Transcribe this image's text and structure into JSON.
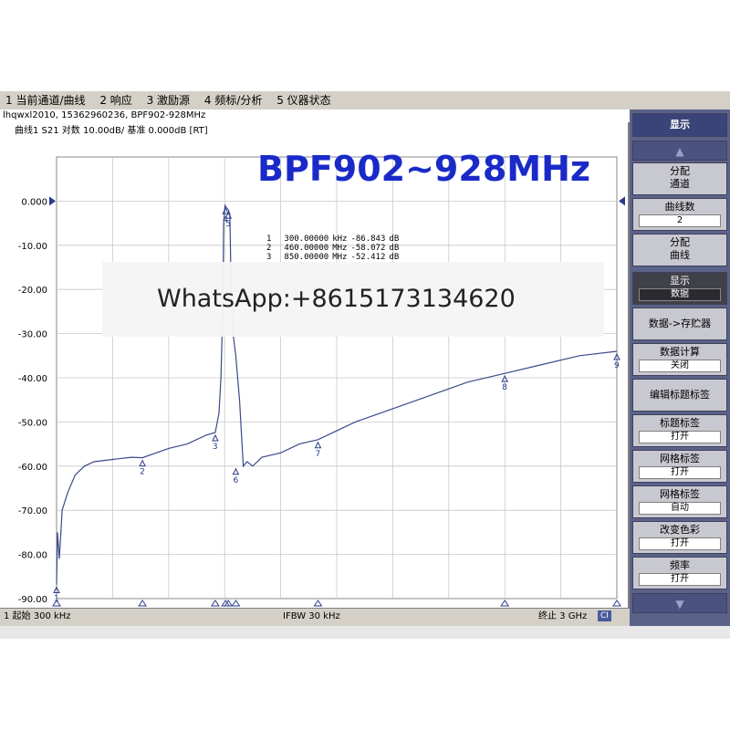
{
  "menubar": {
    "items": [
      "1 当前通道/曲线",
      "2 响应",
      "3 激励源",
      "4 频标/分析",
      "5 仪器状态"
    ]
  },
  "subtitle": "lhqwxl2010, 15362960236, BPF902-928MHz",
  "trace_header": "曲线1 S21 对数 10.00dB/ 基准 0.000dB [RT]",
  "plot_title": "BPF902~928MHz",
  "watermark": "WhatsApp:+8615173134620",
  "markers_table": [
    {
      "idx": "1",
      "freq": "300.00000",
      "unit": "kHz",
      "value": "-86.843",
      "vunit": "dB"
    },
    {
      "idx": "2",
      "freq": "460.00000",
      "unit": "MHz",
      "value": "-58.072",
      "vunit": "dB"
    },
    {
      "idx": "3",
      "freq": "850.00000",
      "unit": "MHz",
      "value": "-52.412",
      "vunit": "dB"
    }
  ],
  "status": {
    "start": "1 起始 300 kHz",
    "ifbw": "IFBW 30 kHz",
    "stop": "终止 3 GHz",
    "ci": "CI"
  },
  "softkeys": {
    "title": "显示",
    "up": "▲",
    "down": "▼",
    "items": [
      {
        "label": "分配\n通道",
        "value": ""
      },
      {
        "label": "曲线数",
        "value": "2"
      },
      {
        "label": "分配\n曲线",
        "value": ""
      },
      {
        "label": "显示",
        "value": "数据"
      },
      {
        "label": "数据->存贮器",
        "value": ""
      },
      {
        "label": "数据计算",
        "value": "关闭"
      },
      {
        "label": "编辑标题标签",
        "value": ""
      },
      {
        "label": "标题标签",
        "value": "打开"
      },
      {
        "label": "网格标签",
        "value": "打开"
      },
      {
        "label": "网格标签",
        "value": "自动"
      },
      {
        "label": "改变色彩",
        "value": "打开"
      },
      {
        "label": "频率",
        "value": "打开"
      }
    ]
  },
  "chart_data": {
    "type": "line",
    "y_ticks": [
      "0.000",
      "-10.00",
      "-20.00",
      "-30.00",
      "-40.00",
      "-50.00",
      "-60.00",
      "-70.00",
      "-80.00",
      "-90.00"
    ],
    "ylim": [
      -90,
      10
    ],
    "x_range_mhz": [
      0.3,
      3000
    ],
    "series": [
      {
        "x": [
          0.3,
          5,
          15,
          30,
          60,
          100,
          150,
          200,
          300,
          400,
          460,
          600,
          700,
          800,
          850,
          870,
          880,
          890,
          895,
          902,
          910,
          920,
          928,
          935,
          945,
          960,
          980,
          1000,
          1020,
          1050,
          1100,
          1200,
          1300,
          1400,
          1500,
          1600,
          1800,
          2000,
          2200,
          2400,
          2600,
          2800,
          3000
        ],
        "y": [
          -86.8,
          -75,
          -81,
          -70,
          -66,
          -62,
          -60,
          -59,
          -58.5,
          -58,
          -58.1,
          -56,
          -55,
          -53,
          -52.4,
          -48,
          -40,
          -25,
          -5,
          -1,
          -1.5,
          -2,
          -3,
          -20,
          -30,
          -35,
          -45,
          -60,
          -59,
          -60,
          -58,
          -57,
          -55,
          -54,
          -52,
          -50,
          -47,
          -44,
          -41,
          -39,
          -37,
          -35,
          -34
        ]
      }
    ],
    "marker_labels": [
      "1",
      "2",
      "3",
      "4",
      "5",
      "6",
      "7",
      "8",
      "9"
    ]
  }
}
